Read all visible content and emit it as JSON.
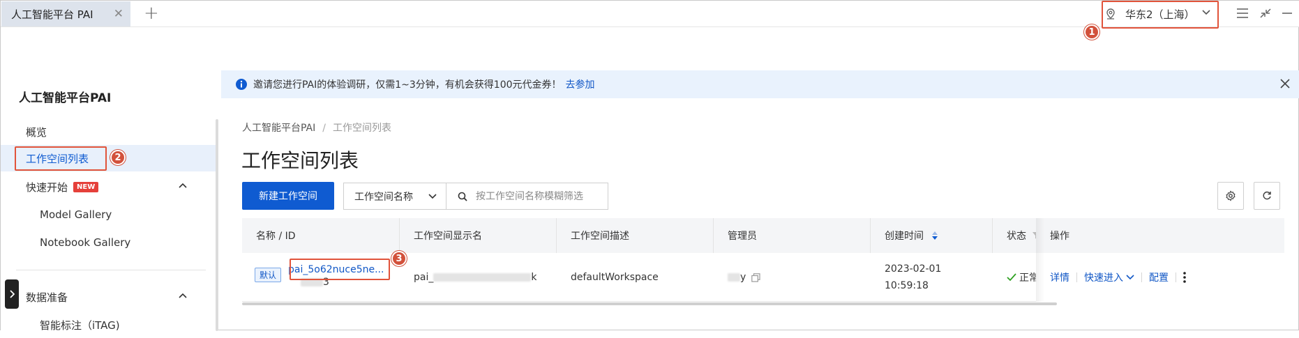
{
  "browser": {
    "tab_title": "人工智能平台 PAI",
    "new_tab_symbol": "+",
    "region_label": "华东2（上海）"
  },
  "markers": [
    "1",
    "2",
    "3"
  ],
  "sidebar": {
    "title": "人工智能平台PAI",
    "items": [
      {
        "label": "概览"
      },
      {
        "label": "工作空间列表"
      },
      {
        "label": "快速开始",
        "badge": "NEW"
      },
      {
        "label": "Model Gallery"
      },
      {
        "label": "Notebook Gallery"
      },
      {
        "label": "数据准备"
      },
      {
        "label": "智能标注（iTAG)"
      }
    ]
  },
  "notice": {
    "text": "邀请您进行PAI的体验调研，仅需1~3分钟，有机会获得100元代金券！",
    "link": "去参加"
  },
  "breadcrumb": [
    "人工智能平台PAI",
    "工作空间列表"
  ],
  "page_title": "工作空间列表",
  "toolbar": {
    "create_label": "新建工作空间",
    "filter_field": "工作空间名称",
    "search_placeholder": "按工作空间名称模糊筛选"
  },
  "table": {
    "columns": [
      "名称 / ID",
      "工作空间显示名",
      "工作空间描述",
      "管理员",
      "创建时间",
      "状态",
      "操作"
    ],
    "rows": [
      {
        "default_tag": "默认",
        "name": "pai_5o62nuce5ne...",
        "id_visible": "3",
        "display_name_start": "pai_",
        "display_name_end": "k",
        "description": "defaultWorkspace",
        "admin_visible": "y",
        "created_date": "2023-02-01",
        "created_time": "10:59:18",
        "status": "正常",
        "ops": [
          "详情",
          "快速进入",
          "配置"
        ]
      }
    ]
  },
  "colors": {
    "primary": "#0f5bd1",
    "annotation": "#e1533a",
    "notice_bg": "#e9f2fd",
    "status_ok": "#2ea121"
  }
}
